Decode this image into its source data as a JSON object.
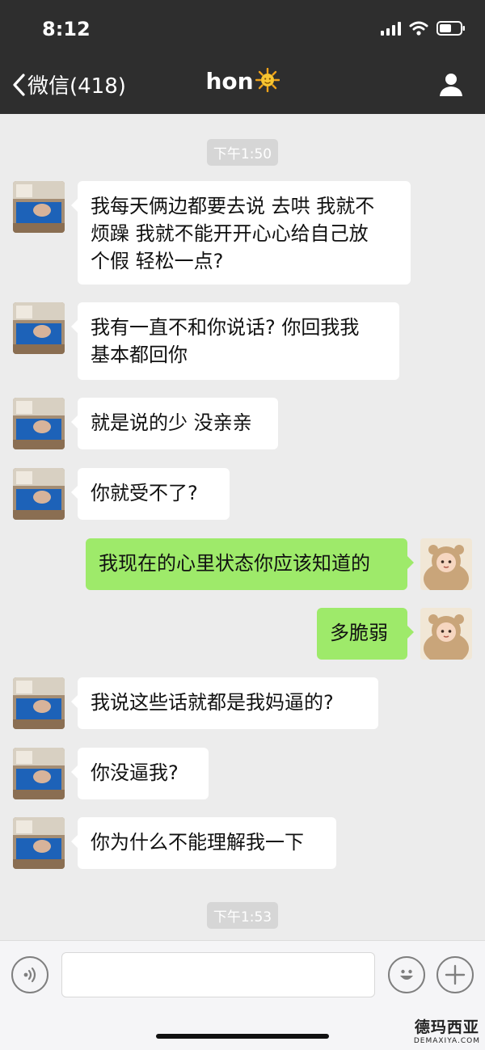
{
  "status_bar": {
    "time": "8:12",
    "icons": [
      "signal-icon",
      "wifi-icon",
      "battery-icon"
    ]
  },
  "nav": {
    "back_label": "微信(418)",
    "title": "hon",
    "title_emoji_icon": "sun-emoji-icon",
    "right_icon": "profile-icon"
  },
  "timestamps": [
    "下午1:50",
    "下午1:53"
  ],
  "messages": [
    {
      "side": "in",
      "text": "我每天俩边都要去说 去哄 我就不\n烦躁  我就不能开开心心给自己放\n个假 轻松一点?"
    },
    {
      "side": "in",
      "text": "我有一直不和你说话? 你回我我\n基本都回你"
    },
    {
      "side": "in",
      "text": "就是说的少 没亲亲"
    },
    {
      "side": "in",
      "text": "你就受不了?"
    },
    {
      "side": "out",
      "text": "我现在的心里状态你应该知道的"
    },
    {
      "side": "out",
      "text": "多脆弱"
    },
    {
      "side": "in",
      "text": "我说这些话就都是我妈逼的?"
    },
    {
      "side": "in",
      "text": "你没逼我?"
    },
    {
      "side": "in",
      "text": "你为什么不能理解我一下"
    }
  ],
  "input_bar": {
    "left_icon": "voice-icon",
    "input_value": "",
    "right_icons": [
      "emoji-icon",
      "plus-icon"
    ]
  },
  "watermark": {
    "cn": "德玛西亚",
    "en": "DEMAXIYA.COM"
  },
  "colors": {
    "nav_bg": "#2e2e2e",
    "chat_bg": "#ececec",
    "outgoing_bubble": "#9eea6a",
    "incoming_bubble": "#ffffff"
  }
}
